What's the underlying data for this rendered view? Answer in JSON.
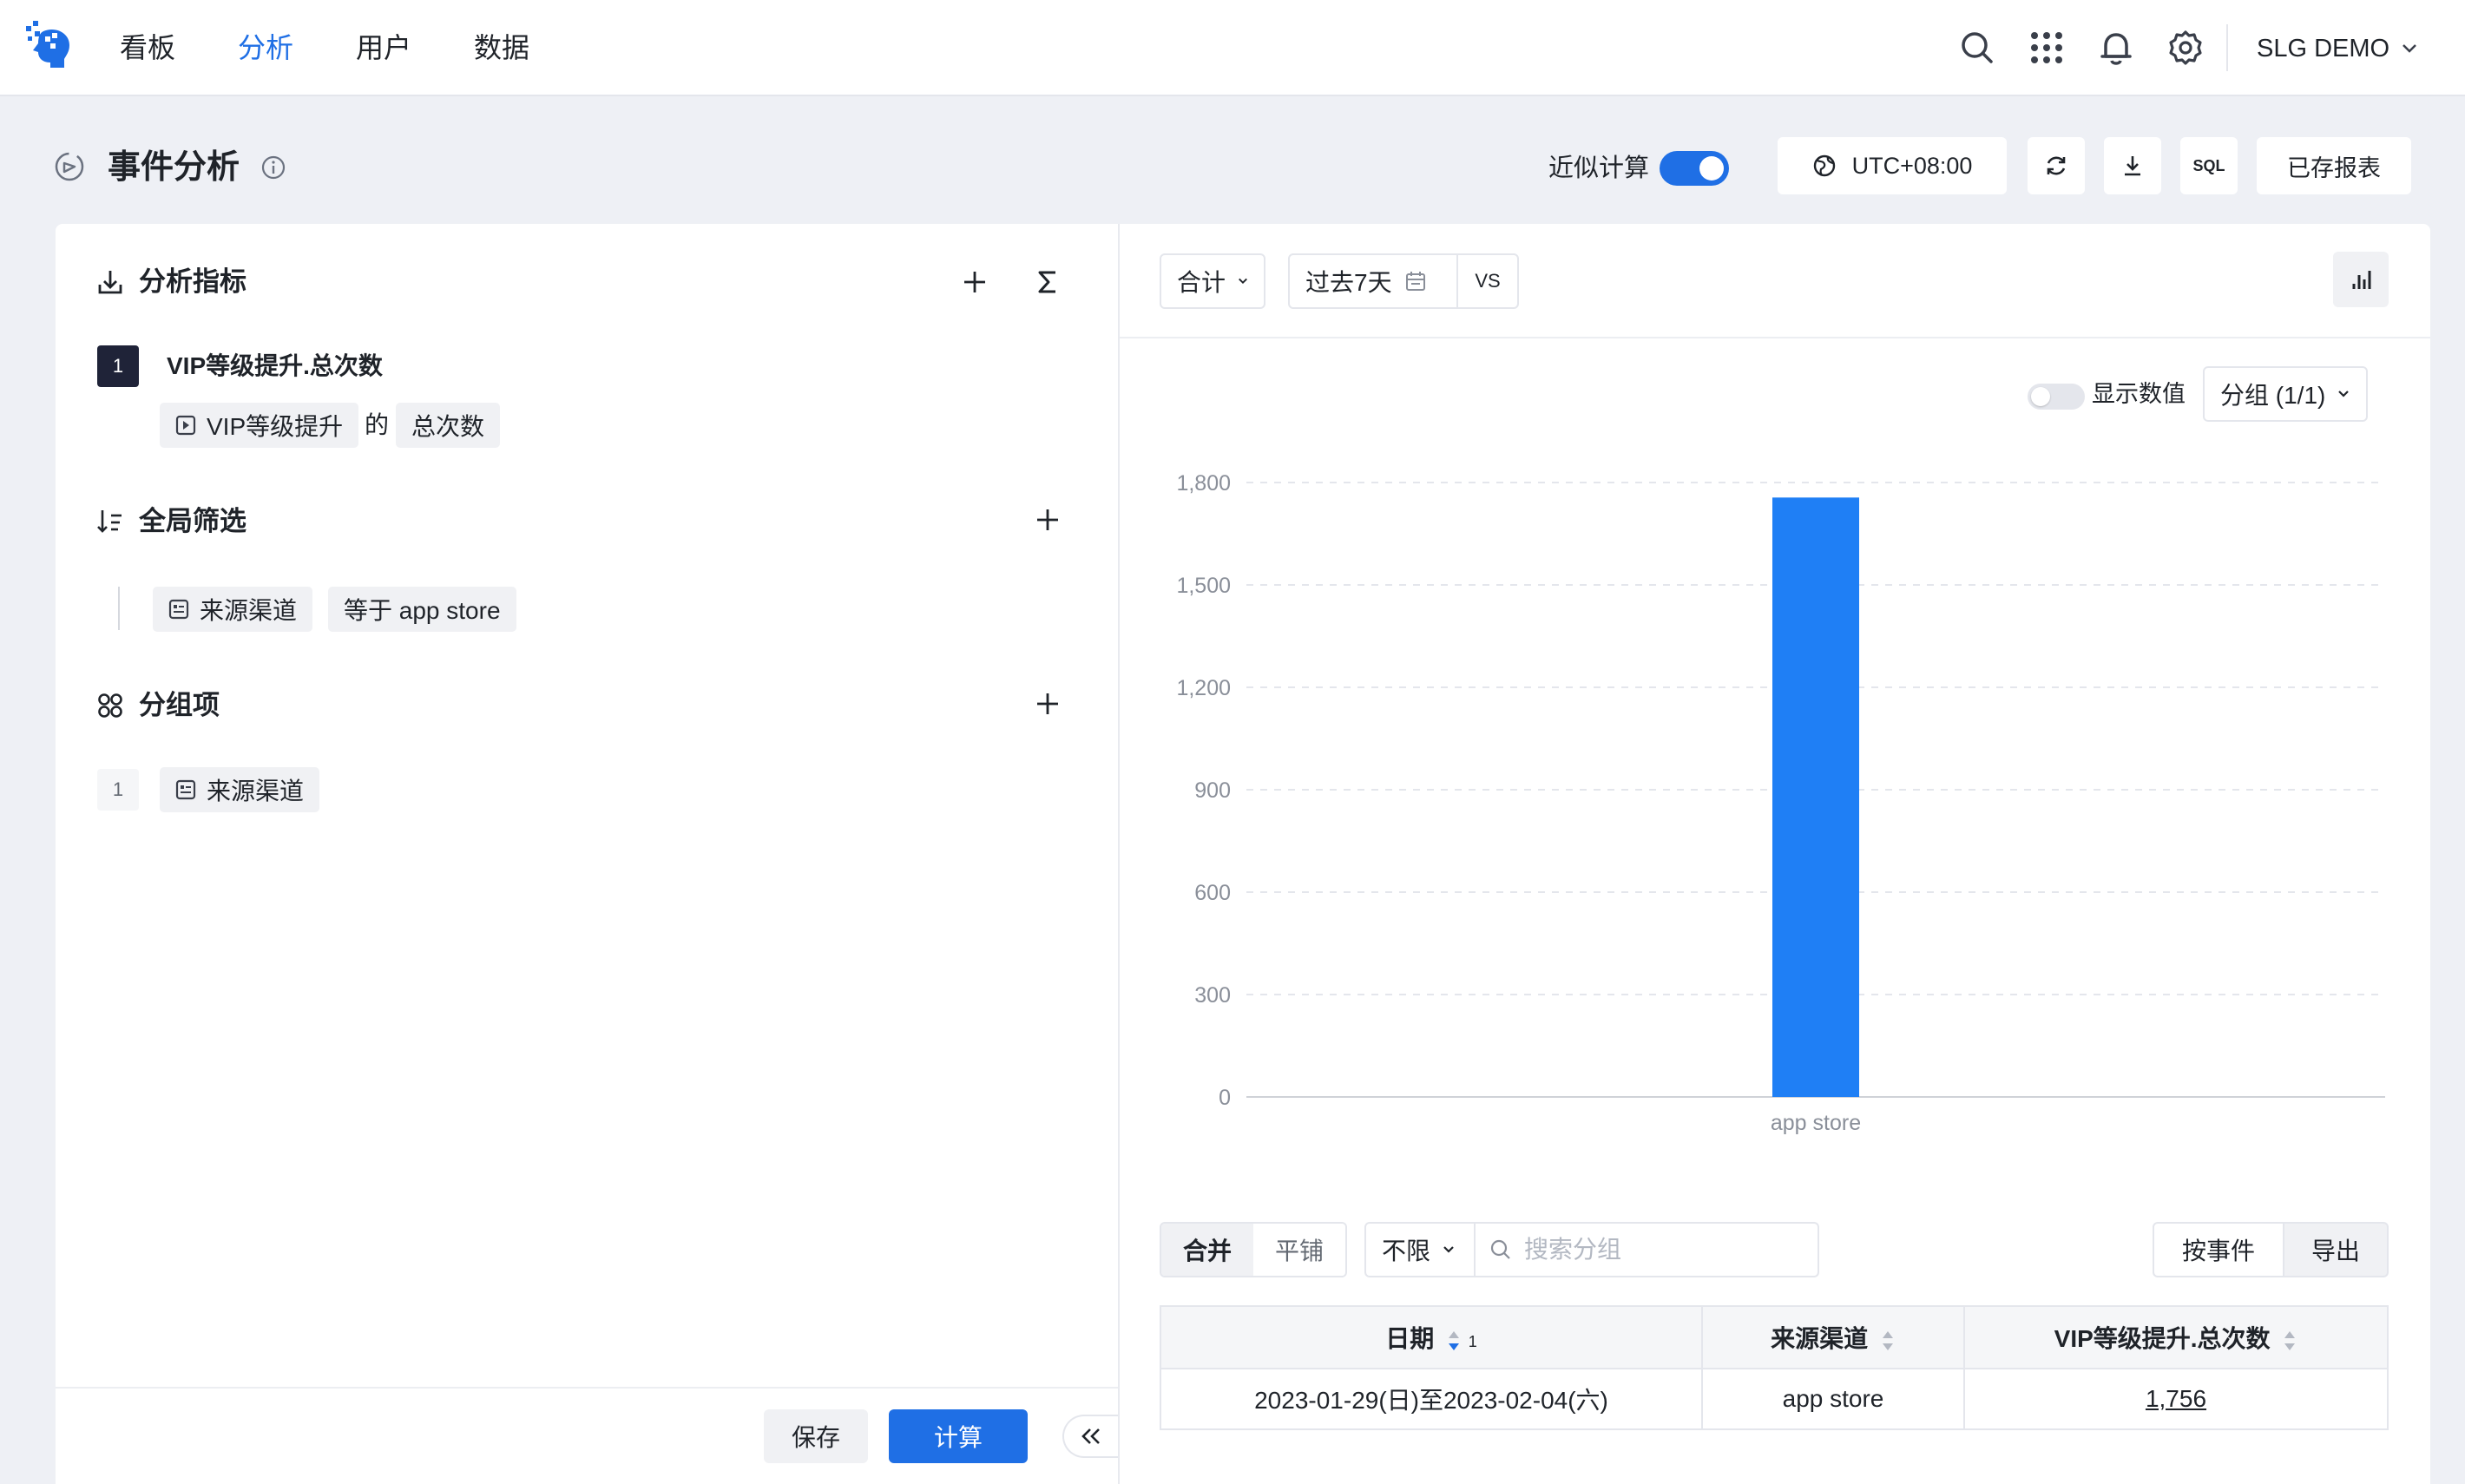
{
  "nav": {
    "items": [
      "看板",
      "分析",
      "用户",
      "数据"
    ],
    "active": "分析",
    "project": "SLG DEMO"
  },
  "header": {
    "title": "事件分析",
    "approx_label": "近似计算",
    "approx_enabled": true,
    "timezone": "UTC+08:00",
    "saved_reports": "已存报表",
    "sql_label": "SQL"
  },
  "metrics": {
    "title": "分析指标",
    "items": [
      {
        "index": "1",
        "name": "VIP等级提升.总次数",
        "event": "VIP等级提升",
        "of": "的",
        "agg": "总次数"
      }
    ]
  },
  "filters": {
    "title": "全局筛选",
    "items": [
      {
        "property": "来源渠道",
        "condition": "等于 app store"
      }
    ]
  },
  "groups": {
    "title": "分组项",
    "items": [
      {
        "index": "1",
        "property": "来源渠道"
      }
    ]
  },
  "footer": {
    "save": "保存",
    "calculate": "计算"
  },
  "controls": {
    "aggregate": "合计",
    "date_range": "过去7天",
    "compare": "VS",
    "show_values_label": "显示数值",
    "show_values": false,
    "group_select": "分组 (1/1)"
  },
  "table_controls": {
    "merge": "合并",
    "tile": "平铺",
    "limit": "不限",
    "search_placeholder": "搜索分组",
    "by_event": "按事件",
    "export": "导出"
  },
  "table": {
    "headers": [
      "日期",
      "来源渠道",
      "VIP等级提升.总次数"
    ],
    "date_sort_index": "1",
    "rows": [
      {
        "date": "2023-01-29(日)至2023-02-04(六)",
        "channel": "app store",
        "value": "1,756"
      }
    ]
  },
  "colors": {
    "accent": "#1f6fe5",
    "bar": "#1f7ff5"
  },
  "chart_data": {
    "type": "bar",
    "categories": [
      "app store"
    ],
    "series": [
      {
        "values": [
          1756
        ]
      }
    ],
    "yticks": [
      0,
      300,
      600,
      900,
      1200,
      1500,
      1800
    ],
    "ylim": [
      0,
      1800
    ],
    "grid": true
  }
}
